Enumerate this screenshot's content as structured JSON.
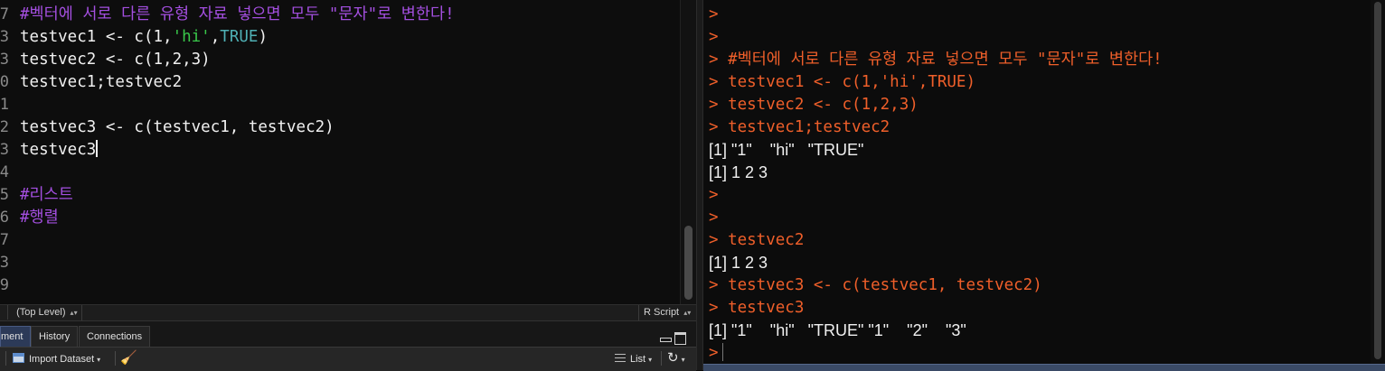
{
  "editor": {
    "line_numbers": [
      "7",
      "3",
      "3",
      "0",
      "1",
      "2",
      "3",
      "4",
      "5",
      "6",
      "7",
      "3",
      "9"
    ],
    "lines": [
      {
        "parts": [
          {
            "text": "#벡터에 서로 다른 유형 자료 넣으면 모두 \"문자\"로 변한다!",
            "cls": "comment"
          }
        ]
      },
      {
        "parts": [
          {
            "text": "testvec1 <- c(1,",
            "cls": ""
          },
          {
            "text": "'hi'",
            "cls": "str"
          },
          {
            "text": ",",
            "cls": ""
          },
          {
            "text": "TRUE",
            "cls": "kw"
          },
          {
            "text": ")",
            "cls": ""
          }
        ]
      },
      {
        "parts": [
          {
            "text": "testvec2 <- c(1,2,3)",
            "cls": ""
          }
        ]
      },
      {
        "parts": [
          {
            "text": "testvec1;testvec2",
            "cls": ""
          }
        ]
      },
      {
        "parts": []
      },
      {
        "parts": [
          {
            "text": "testvec3 <- c(testvec1, testvec2)",
            "cls": ""
          }
        ]
      },
      {
        "parts": [
          {
            "text": "testvec3",
            "cls": ""
          }
        ],
        "cursor": true
      },
      {
        "parts": []
      },
      {
        "parts": [
          {
            "text": "#리스트",
            "cls": "comment"
          }
        ]
      },
      {
        "parts": [
          {
            "text": "#행렬",
            "cls": "comment"
          }
        ]
      },
      {
        "parts": []
      },
      {
        "parts": []
      },
      {
        "parts": []
      }
    ]
  },
  "statusbar": {
    "scope": "(Top Level)",
    "file_type": "R Script"
  },
  "pane": {
    "tabs": [
      {
        "label": "ment",
        "active": true
      },
      {
        "label": "History",
        "active": false
      },
      {
        "label": "Connections",
        "active": false
      }
    ],
    "toolbar": {
      "import_label": "Import Dataset",
      "view_label": "List",
      "broom_icon": "broom-icon",
      "refresh_icon": "refresh-icon"
    }
  },
  "console": {
    "lines": [
      {
        "text": ">",
        "kind": "in"
      },
      {
        "text": ">",
        "kind": "in"
      },
      {
        "text": "> #벡터에 서로 다른 유형 자료 넣으면 모두 \"문자\"로 변한다!",
        "kind": "in"
      },
      {
        "text": "> testvec1 <- c(1,'hi',TRUE)",
        "kind": "in"
      },
      {
        "text": "> testvec2 <- c(1,2,3)",
        "kind": "in"
      },
      {
        "text": "> testvec1;testvec2",
        "kind": "in"
      },
      {
        "text": "[1] \"1\"    \"hi\"   \"TRUE\"",
        "kind": "out"
      },
      {
        "text": "[1] 1 2 3",
        "kind": "out"
      },
      {
        "text": ">",
        "kind": "in"
      },
      {
        "text": ">",
        "kind": "in"
      },
      {
        "text": "> testvec2",
        "kind": "in"
      },
      {
        "text": "[1] 1 2 3",
        "kind": "out"
      },
      {
        "text": "> testvec3 <- c(testvec1, testvec2)",
        "kind": "in"
      },
      {
        "text": "> testvec3",
        "kind": "in"
      },
      {
        "text": "[1] \"1\"    \"hi\"   \"TRUE\" \"1\"    \"2\"    \"3\"",
        "kind": "out"
      },
      {
        "text": ">",
        "kind": "in",
        "prompt": true
      }
    ]
  },
  "colors": {
    "comment": "#a44fe0",
    "string": "#39c84a",
    "keyword": "#4fb0b4",
    "console_input": "#ef5f2a",
    "console_output": "#f0f0f0"
  }
}
